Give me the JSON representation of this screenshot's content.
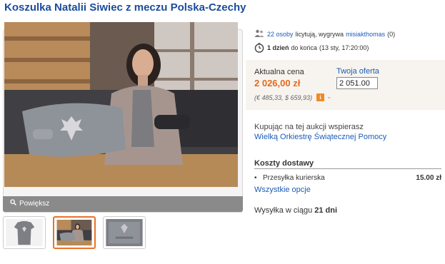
{
  "title": "Koszulka Natalii Siwiec z meczu Polska-Czechy",
  "gallery": {
    "zoom_label": "Powiększ",
    "thumbnails": [
      "shirt-front",
      "woman-holding-shirt",
      "shirt-detail"
    ],
    "active_thumbnail": 1
  },
  "bidders": {
    "count_link": "22 osoby",
    "text": "licytują, wygrywa",
    "winner": "misiakthomas",
    "winner_rating": "(0)"
  },
  "time_left": {
    "value": "1 dzień",
    "text": "do końca",
    "date": "(13 sty, 17:20:00)"
  },
  "price": {
    "label": "Aktualna cena",
    "value": "2 026,00 zł",
    "fx": "(€ 485,33, $ 659,93)"
  },
  "offer": {
    "label": "Twoja oferta",
    "value": "2 051.00"
  },
  "support": {
    "text": "Kupując na tej aukcji wspierasz",
    "link": "Wielką Orkiestrę Świątecznej Pomocy"
  },
  "shipping": {
    "title": "Koszty dostawy",
    "method": "Przesyłka kurierska",
    "price": "15.00 zł",
    "all_options": "Wszystkie opcje"
  },
  "dispatch": {
    "prefix": "Wysyłka w ciągu",
    "days": "21 dni"
  },
  "colors": {
    "title": "#1a4c9a",
    "price": "#e36b1f",
    "link": "#1a5db8",
    "active_thumb_border": "#e8732a"
  }
}
